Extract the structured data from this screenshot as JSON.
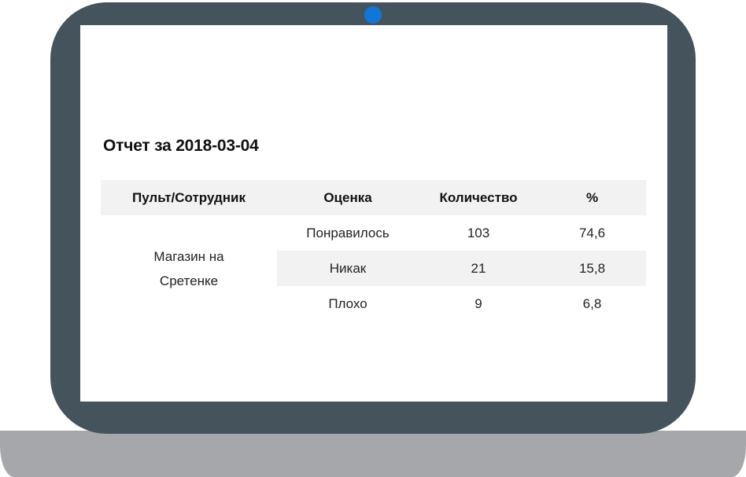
{
  "report": {
    "title": "Отчет за 2018-03-04",
    "columns": [
      "Пульт/Сотрудник",
      "Оценка",
      "Количество",
      "%"
    ],
    "group": {
      "line1": "Магазин на",
      "line2": "Сретенке"
    },
    "rows": [
      {
        "rating": "Понравилось",
        "count": "103",
        "percent": "74,6"
      },
      {
        "rating": "Никак",
        "count": "21",
        "percent": "15,8"
      },
      {
        "rating": "Плохо",
        "count": "9",
        "percent": "6,8"
      }
    ]
  },
  "colors": {
    "lid": "#44535c",
    "base": "#a5a7aa",
    "camera": "#1177d6",
    "stripe": "#f2f2f2"
  }
}
